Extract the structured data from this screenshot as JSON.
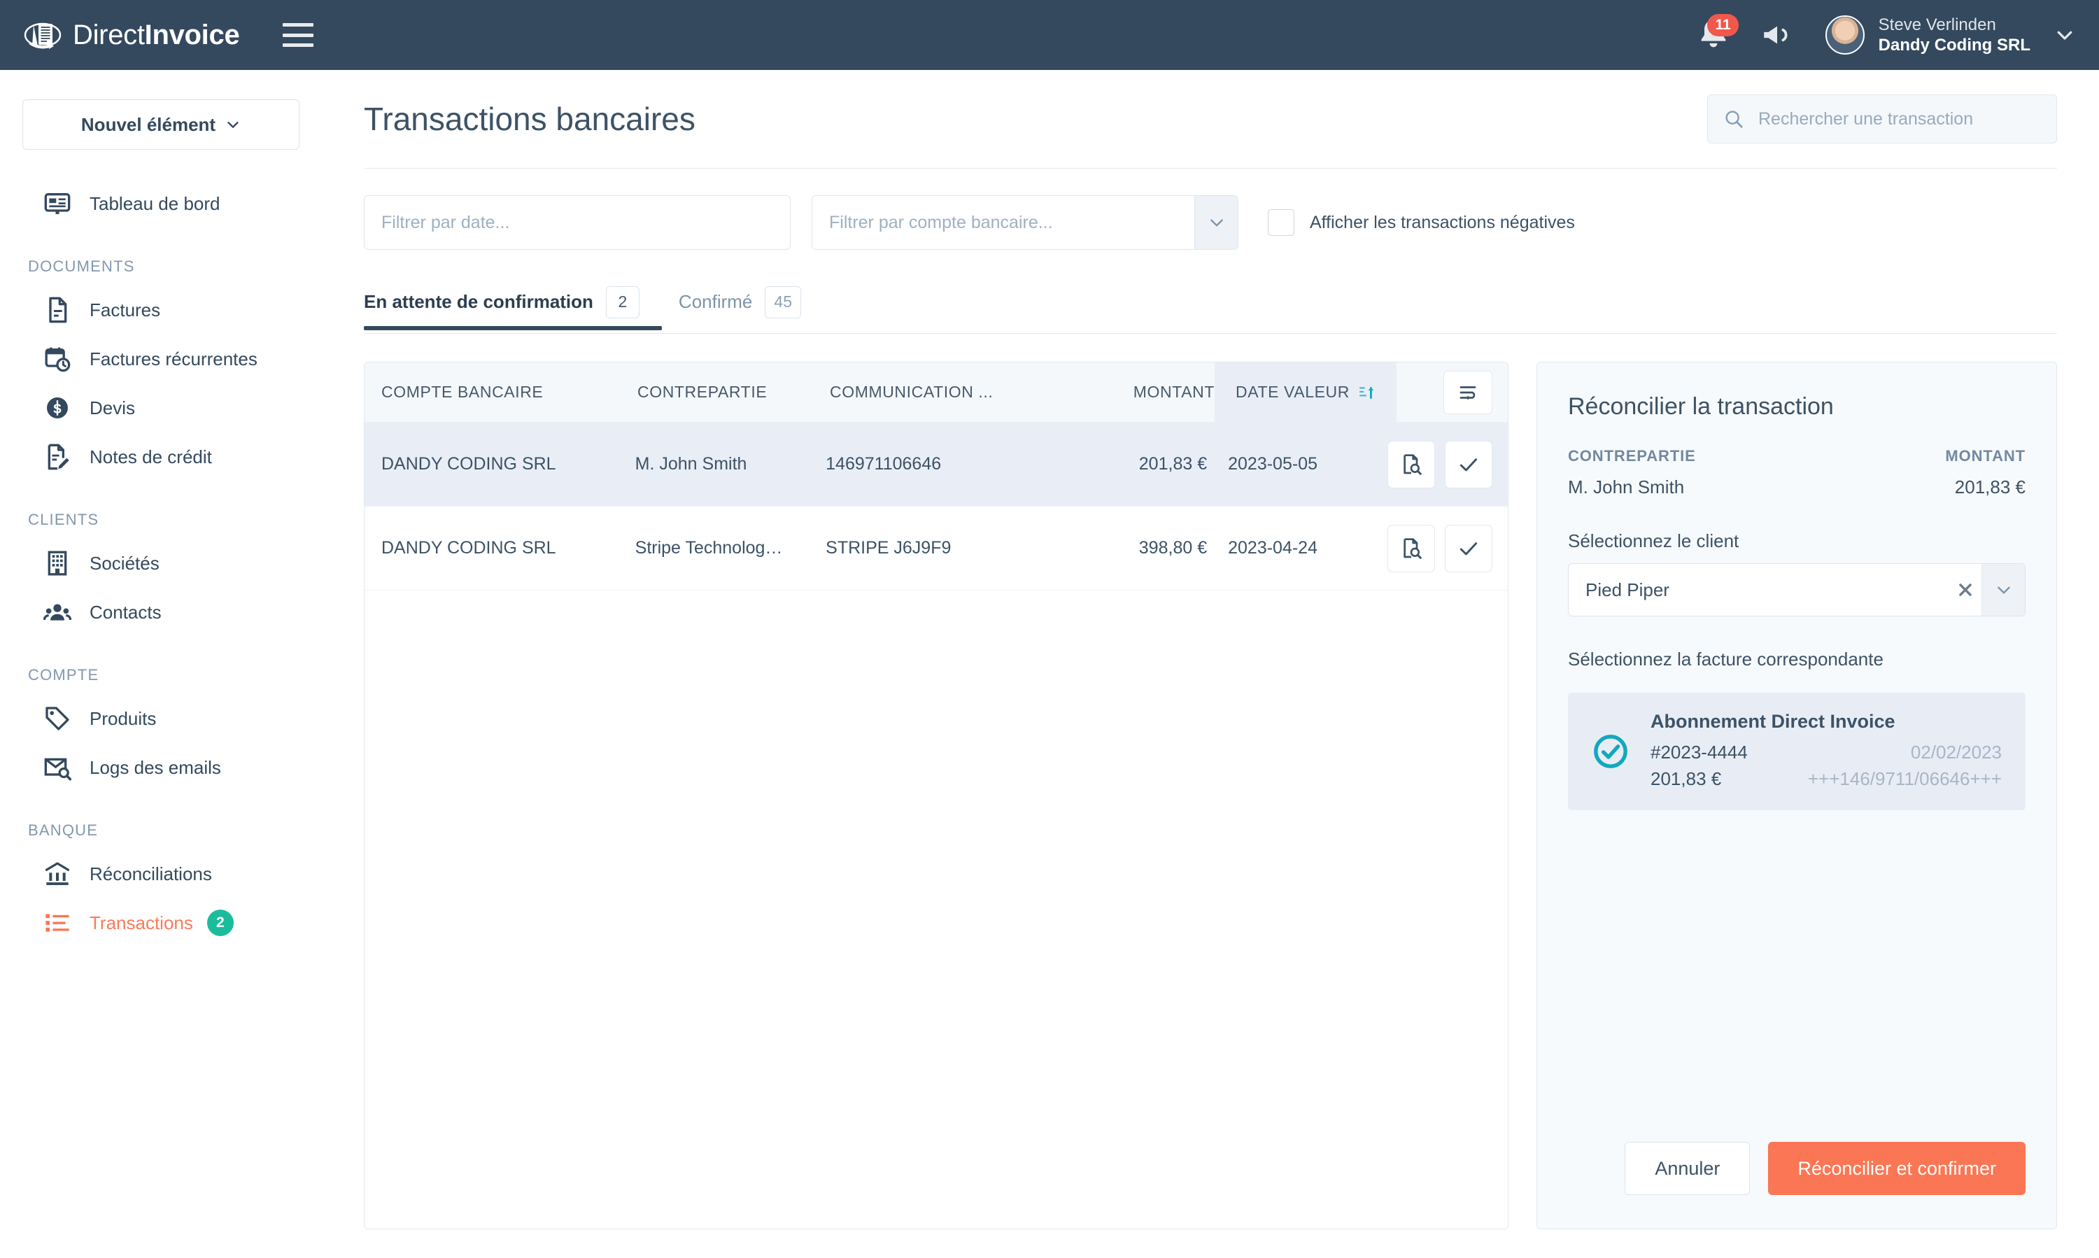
{
  "brand": {
    "name_light": "Direct",
    "name_bold": "Invoice",
    "logo_icon": "document-stack-icon",
    "menu_icon": "hamburger-icon"
  },
  "topbar": {
    "notifications": {
      "icon": "bell-icon",
      "count": "11"
    },
    "announcements": {
      "icon": "megaphone-icon"
    },
    "user": {
      "name": "Steve Verlinden",
      "org": "Dandy Coding SRL",
      "avatar_icon": "avatar",
      "caret_icon": "chevron-down-icon"
    }
  },
  "sidebar": {
    "new_item": {
      "label": "Nouvel élément",
      "icon": "chevron-down-icon"
    },
    "top_items": [
      {
        "label": "Tableau de bord",
        "icon": "dashboard-icon"
      }
    ],
    "sections": [
      {
        "label": "DOCUMENTS",
        "items": [
          {
            "label": "Factures",
            "icon": "file-icon"
          },
          {
            "label": "Factures récurrentes",
            "icon": "calendar-clock-icon"
          },
          {
            "label": "Devis",
            "icon": "coin-icon"
          },
          {
            "label": "Notes de crédit",
            "icon": "file-edit-icon"
          }
        ]
      },
      {
        "label": "CLIENTS",
        "items": [
          {
            "label": "Sociétés",
            "icon": "building-icon"
          },
          {
            "label": "Contacts",
            "icon": "people-icon"
          }
        ]
      },
      {
        "label": "COMPTE",
        "items": [
          {
            "label": "Produits",
            "icon": "tag-icon"
          },
          {
            "label": "Logs des emails",
            "icon": "mail-search-icon"
          }
        ]
      },
      {
        "label": "BANQUE",
        "items": [
          {
            "label": "Réconciliations",
            "icon": "bank-icon"
          },
          {
            "label": "Transactions",
            "icon": "list-icon",
            "badge": "2",
            "active": true
          }
        ]
      }
    ]
  },
  "page": {
    "title": "Transactions bancaires",
    "search": {
      "placeholder": "Rechercher une transaction",
      "icon": "search-icon",
      "value": ""
    }
  },
  "filters": {
    "date": {
      "placeholder": "Filtrer par date...",
      "value": ""
    },
    "bank_account": {
      "placeholder": "Filtrer par compte bancaire...",
      "value": "",
      "icon": "chevron-down-icon"
    },
    "negative_transactions": {
      "label": "Afficher les transactions négatives",
      "checked": false
    }
  },
  "tabs": [
    {
      "label": "En attente de confirmation",
      "count": "2",
      "active": true
    },
    {
      "label": "Confirmé",
      "count": "45",
      "active": false
    }
  ],
  "table": {
    "columns": [
      "COMPTE BANCAIRE",
      "CONTREPARTIE",
      "COMMUNICATION ...",
      "MONTANT",
      "DATE VALEUR"
    ],
    "sort": {
      "column": "DATE VALEUR",
      "direction": "asc",
      "icon": "sort-ascending-icon"
    },
    "wrap_toggle_icon": "text-wrap-icon",
    "rows": [
      {
        "bank_account": "DANDY CODING SRL",
        "counterparty": "M. John Smith",
        "communication": "146971106646",
        "amount": "201,83 €",
        "value_date": "2023-05-05",
        "selected": true,
        "actions": [
          {
            "icon": "document-search-icon"
          },
          {
            "icon": "check-icon"
          }
        ]
      },
      {
        "bank_account": "DANDY CODING SRL",
        "counterparty": "Stripe Technolog…",
        "communication": "STRIPE J6J9F9",
        "amount": "398,80 €",
        "value_date": "2023-04-24",
        "selected": false,
        "actions": [
          {
            "icon": "document-search-icon"
          },
          {
            "icon": "check-icon"
          }
        ]
      }
    ]
  },
  "panel": {
    "title": "Réconcilier la transaction",
    "counterparty_label": "CONTREPARTIE",
    "amount_label": "MONTANT",
    "counterparty_value": "M. John Smith",
    "amount_value": "201,83 €",
    "client_field_label": "Sélectionnez le client",
    "client_value": "Pied Piper",
    "client_clear_icon": "close-icon",
    "client_arrow_icon": "chevron-down-icon",
    "invoice_field_label": "Sélectionnez la facture correspondante",
    "invoice": {
      "check_icon": "check-circle-icon",
      "title": "Abonnement Direct Invoice",
      "number": "#2023-4444",
      "date": "02/02/2023",
      "amount": "201,83 €",
      "structured_ref": "+++146/9711/06646+++",
      "selected": true
    },
    "cancel_label": "Annuler",
    "confirm_label": "Réconcilier et confirmer"
  },
  "colors": {
    "topbar_bg": "#34495e",
    "accent_orange": "#fb7654",
    "badge_green": "#1abc9c",
    "badge_red": "#f2574b",
    "sort_teal": "#0fa8bf",
    "check_teal": "#12a8bd",
    "selected_row": "#e9eef6"
  }
}
